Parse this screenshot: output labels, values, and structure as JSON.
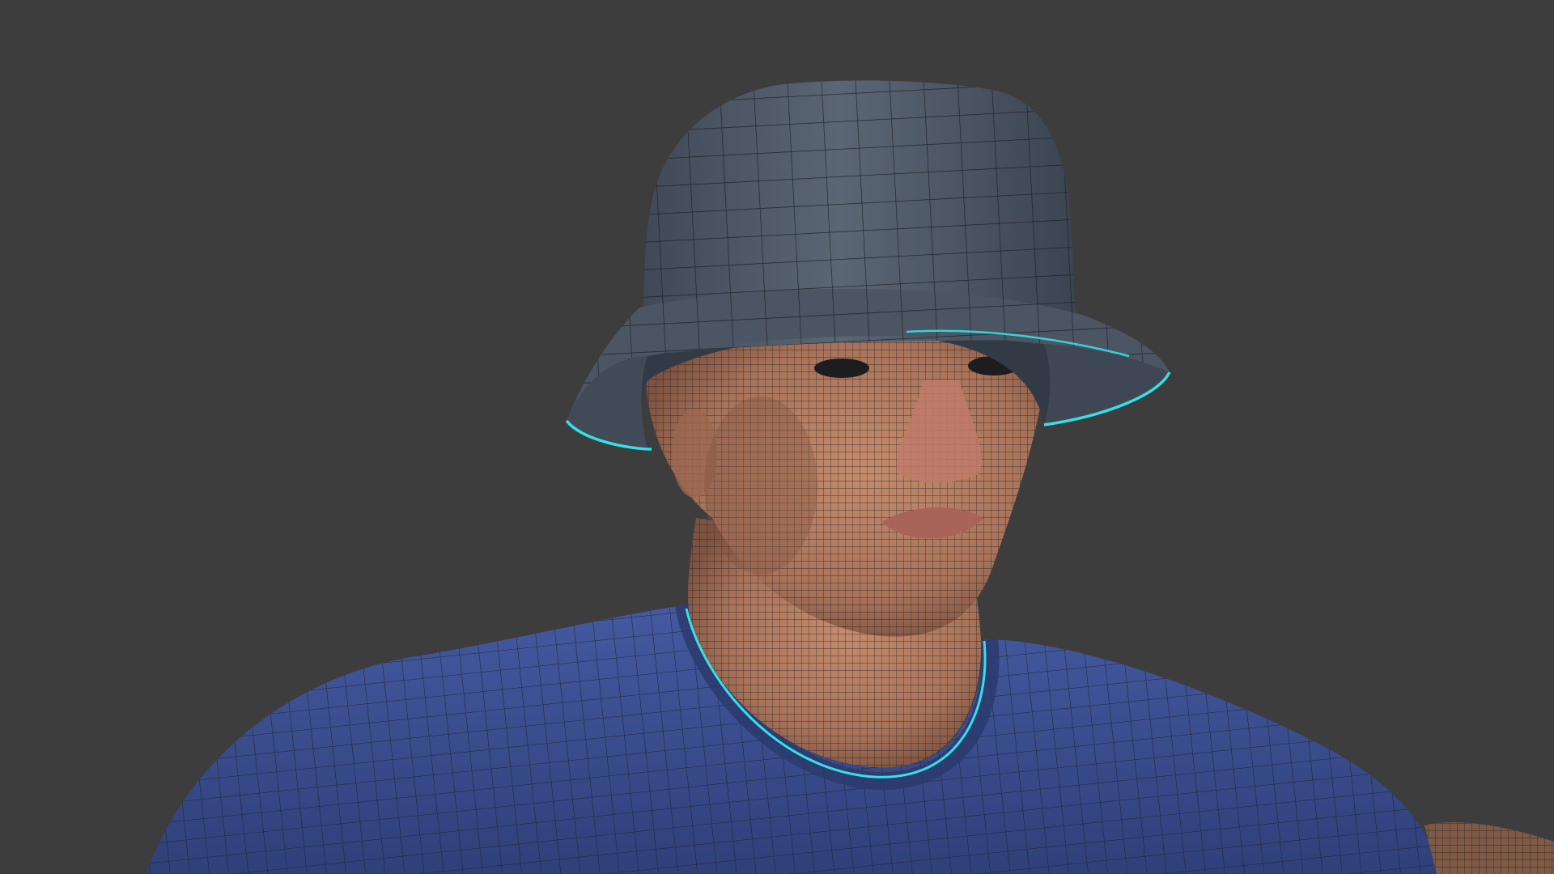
{
  "viewport": {
    "background_color": "#3d3d3d",
    "selection_outline_color": "#35e0e6",
    "wire_color": "#1b1b1b"
  },
  "subject": {
    "hat": {
      "color": "#4d5867",
      "shade_color": "#38414d"
    },
    "skin": {
      "color": "#b57f63",
      "shade_color": "#8a5a45",
      "lip_color": "#a86458",
      "nose_color": "#c07a6a"
    },
    "shirt": {
      "color": "#3e5395",
      "shade_color": "#2c3c70"
    }
  }
}
